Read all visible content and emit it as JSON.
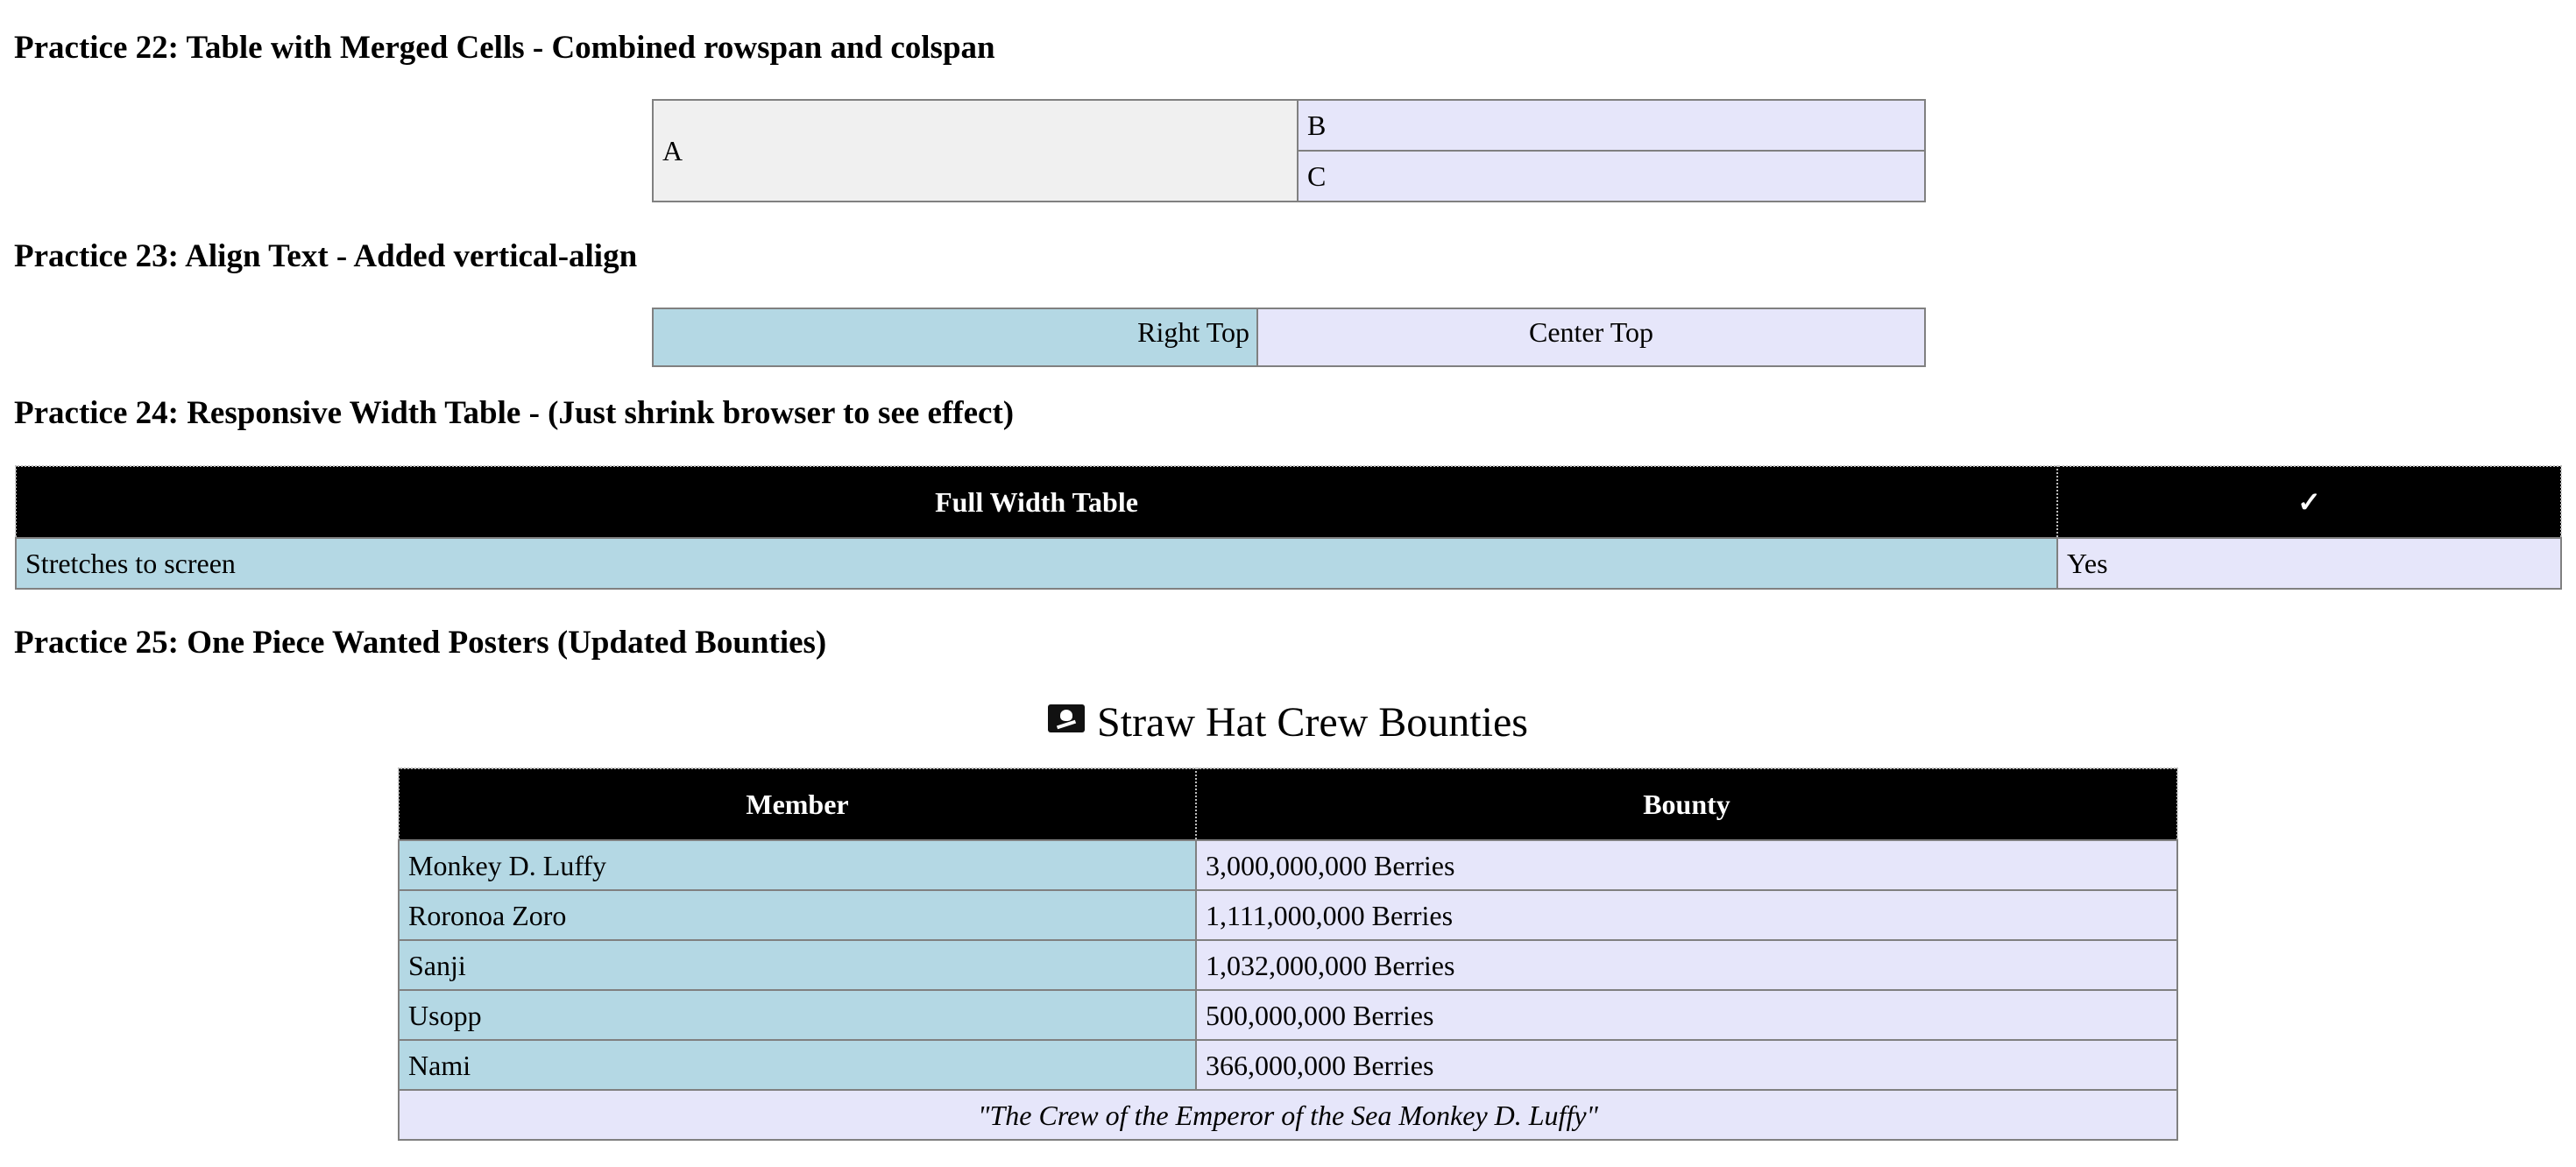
{
  "practice22": {
    "heading": "Practice 22: Table with Merged Cells - Combined rowspan and colspan",
    "cell_a": "A",
    "cell_b": "B",
    "cell_c": "C",
    "colors": {
      "gray": "#f0f0f0",
      "lavender": "#e6e6fa"
    }
  },
  "practice23": {
    "heading": "Practice 23: Align Text - Added vertical-align",
    "cell_right_top": "Right Top",
    "cell_center_top": "Center Top",
    "colors": {
      "light_blue": "#b4d8e4",
      "lavender": "#e6e6fa"
    }
  },
  "practice24": {
    "heading": "Practice 24: Responsive Width Table - (Just shrink browser to see effect)",
    "header": [
      "Full Width Table",
      "✓"
    ],
    "row": [
      "Stretches to screen",
      "Yes"
    ],
    "colors": {
      "header_bg": "#000000",
      "header_text": "#ffffff"
    }
  },
  "practice25": {
    "heading": "Practice 25: One Piece Wanted Posters (Updated Bounties)",
    "caption_icon": "pirate-flag-icon",
    "caption": "Straw Hat Crew Bounties",
    "columns": [
      "Member",
      "Bounty"
    ],
    "rows": [
      {
        "member": "Monkey D. Luffy",
        "bounty": "3,000,000,000 Berries"
      },
      {
        "member": "Roronoa Zoro",
        "bounty": "1,111,000,000 Berries"
      },
      {
        "member": "Sanji",
        "bounty": "1,032,000,000 Berries"
      },
      {
        "member": "Usopp",
        "bounty": "500,000,000 Berries"
      },
      {
        "member": "Nami",
        "bounty": "366,000,000 Berries"
      }
    ],
    "footer": "\"The Crew of the Emperor of the Sea Monkey D. Luffy\""
  }
}
